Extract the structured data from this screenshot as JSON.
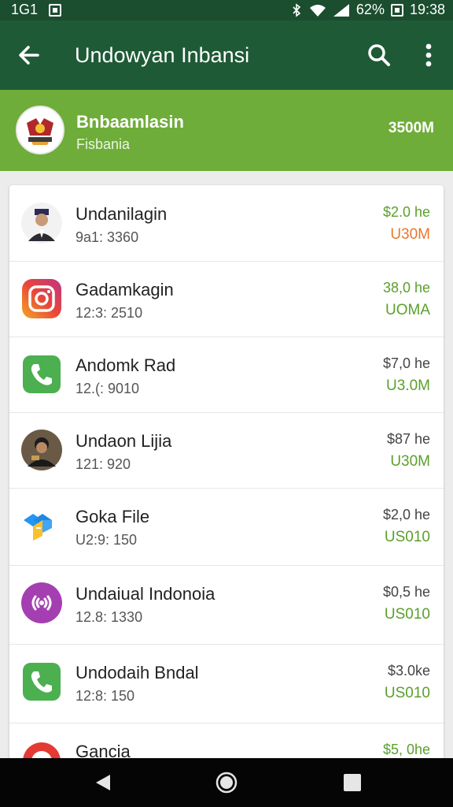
{
  "status": {
    "left_text": "1G1",
    "battery": "62%",
    "time": "19:38"
  },
  "app_bar": {
    "title": "Undowyan Inbansi",
    "back_icon": "arrow-left-icon",
    "search_icon": "search-icon",
    "more_icon": "more-vert-icon"
  },
  "banner": {
    "name": "Bnbaamlasin",
    "subtitle": "Fisbania",
    "amount": "3500M"
  },
  "colors": {
    "app_bar": "#1e5a36",
    "banner": "#6fad3a",
    "green_text": "#5aa02c",
    "orange_text": "#e8772e"
  },
  "items": [
    {
      "name": "Undanilagin",
      "sub": "9a1: 3360",
      "value": "$2.0 he",
      "amount": "U30M",
      "icon": "person-avatar-icon",
      "value_color": "#5aa02c",
      "amount_color": "#e8772e"
    },
    {
      "name": "Gadamkagin",
      "sub": "12:3: 2510",
      "value": "38,0 he",
      "amount": "UOMA",
      "icon": "instagram-icon",
      "value_color": "#5aa02c",
      "amount_color": "#5aa02c"
    },
    {
      "name": "Andomk Rad",
      "sub": "12.(: 9010",
      "value": "$7,0 he",
      "amount": "U3.0M",
      "icon": "phone-icon",
      "value_color": "#444444",
      "amount_color": "#5aa02c"
    },
    {
      "name": "Undaon Lijia",
      "sub": "121: 920",
      "value": "$87 he",
      "amount": "U30M",
      "icon": "person-avatar-icon",
      "value_color": "#444444",
      "amount_color": "#5aa02c"
    },
    {
      "name": "Goka File",
      "sub": "U2:9: 150",
      "value": "$2,0 he",
      "amount": "US010",
      "icon": "files-icon",
      "value_color": "#444444",
      "amount_color": "#5aa02c"
    },
    {
      "name": "Undaiual Indonoia",
      "sub": "12.8: 1330",
      "value": "$0,5 he",
      "amount": "US010",
      "icon": "podcast-icon",
      "value_color": "#444444",
      "amount_color": "#5aa02c"
    },
    {
      "name": "Undodaih Bndal",
      "sub": "12:8: 150",
      "value": "$3.0ke",
      "amount": "US010",
      "icon": "phone-icon",
      "value_color": "#444444",
      "amount_color": "#5aa02c"
    },
    {
      "name": "Gancia",
      "sub": "",
      "value": "$5, 0he",
      "amount": "",
      "icon": "app-icon",
      "value_color": "#5aa02c",
      "amount_color": "#5aa02c"
    }
  ]
}
